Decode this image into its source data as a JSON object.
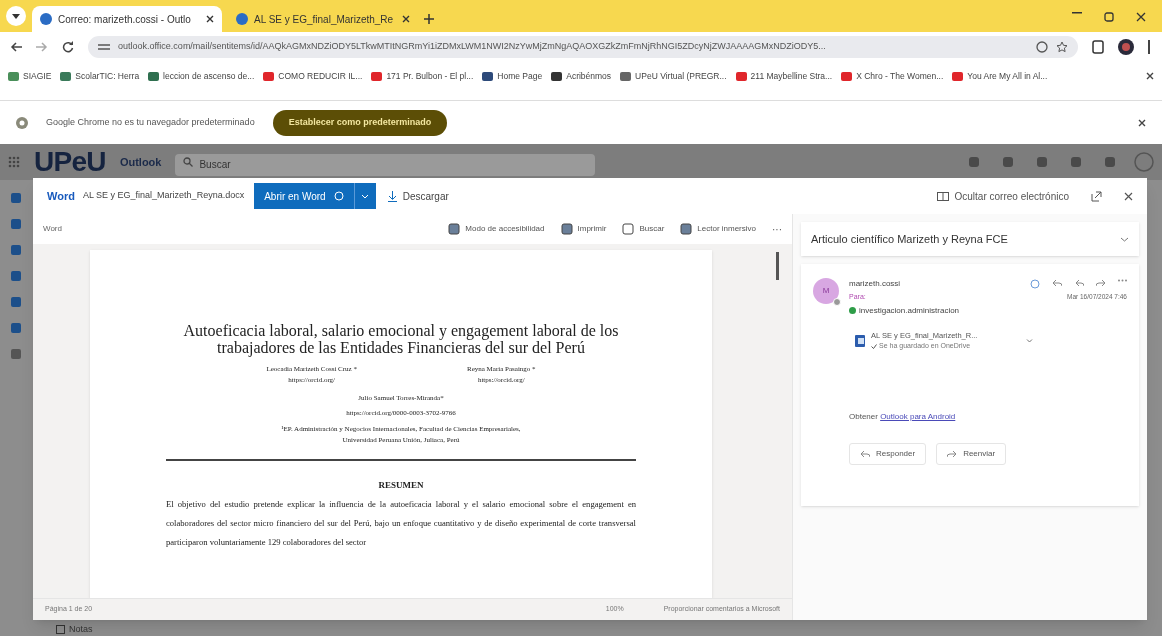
{
  "browser": {
    "tabs": [
      {
        "title": "Correo: marizeth.cossi - Outlo",
        "selected": true
      },
      {
        "title": "AL SE y EG_final_Marizeth_Re",
        "selected": false
      }
    ],
    "url": "outlook.office.com/mail/sentitems/id/AAQkAGMxNDZiODY5LTkwMTItNGRmYi1iZDMxLWM1NWI2NzYwMjZmNgAQAOXGZkZmFmNjRhNGI5ZDcyNjZWJAAAAGMxNDZiODY5...",
    "bookmarks": [
      {
        "label": "SIAGIE",
        "color": "#4a8f5a"
      },
      {
        "label": "ScolarTIC: Herra",
        "color": "#3a7a5a"
      },
      {
        "label": "leccion de ascenso de...",
        "color": "#2f6f4f"
      },
      {
        "label": "COMO REDUCIR IL...",
        "color": "#e0262b"
      },
      {
        "label": "171 Pr. Bulbon - El pl...",
        "color": "#e0262b"
      },
      {
        "label": "Home Page",
        "color": "#2d4a7a"
      },
      {
        "label": "Acribénmos",
        "color": "#333333"
      },
      {
        "label": "UPeU Virtual (PREGR...",
        "color": "#666666"
      },
      {
        "label": "211 Maybelline Stra...",
        "color": "#e0262b"
      },
      {
        "label": "X Chro - The Women...",
        "color": "#e0262b"
      },
      {
        "label": "You Are My All in Al...",
        "color": "#e0262b"
      }
    ],
    "infobar": {
      "message": "Google Chrome no es tu navegador predeterminado",
      "button": "Establecer como predeterminado"
    }
  },
  "outlook": {
    "brand": "UPeU",
    "app": "Outlook",
    "search_placeholder": "Buscar",
    "nav_item": "Notas"
  },
  "viewer": {
    "app": "Word",
    "filename": "AL SE y EG_final_Marizeth_Reyna.docx",
    "open_button": "Abrir en Word",
    "download": "Descargar",
    "hide_mail": "Ocultar correo electrónico",
    "toolbar": {
      "label": "Word",
      "actions": [
        "Modo de accesibilidad",
        "Imprimir",
        "Buscar",
        "Lector inmersivo"
      ],
      "more": "···"
    },
    "document": {
      "title": "Autoeficacia laboral, salario emocional y engagement laboral de los trabajadores de las Entidades Financieras del sur del Perú",
      "authors": [
        {
          "name": "Leocadia Marizeth Cossi Cruz *",
          "link": "https://orcid.org/"
        },
        {
          "name": "Reyna Maria Pasaingo *",
          "link": "https://orcid.org/"
        }
      ],
      "third_author": {
        "name": "Julio Samuel Torres-Miranda*",
        "link": "https://orcid.org/0000-0003-3702-9766"
      },
      "affiliation": [
        "¹EP. Administración y Negocios Internacionales, Facultad de Ciencias Empresariales,",
        "Universidad Peruana Unión, Juliaca, Perú"
      ],
      "heading": "RESUMEN",
      "abstract": "El objetivo del estudio pretende explicar la influencia de la autoeficacia laboral y el salario emocional sobre el engagement en colaboradores del sector micro financiero del sur del Perú, bajo un enfoque cuantitativo y de diseño experimental de corte transversal participaron voluntariamente 129 colaboradores del sector"
    },
    "status": {
      "page": "Página 1 de 20",
      "zoom": "100%",
      "feedback": "Proporcionar comentarios a Microsoft"
    }
  },
  "email": {
    "subject": "Articulo científico Marizeth y Reyna FCE",
    "avatar": "M",
    "sender": "marizeth.cossi",
    "to": "Para:",
    "date": "Mar 16/07/2024 7:46",
    "recipient": "investigacion.administracion",
    "attachment": {
      "name": "AL SE y EG_final_Marizeth_R...",
      "status": "Se ha guardado en OneDrive"
    },
    "get_prefix": "Obtener",
    "get_link": "Outlook para Android",
    "actions": [
      "Responder",
      "Reenviar"
    ]
  }
}
